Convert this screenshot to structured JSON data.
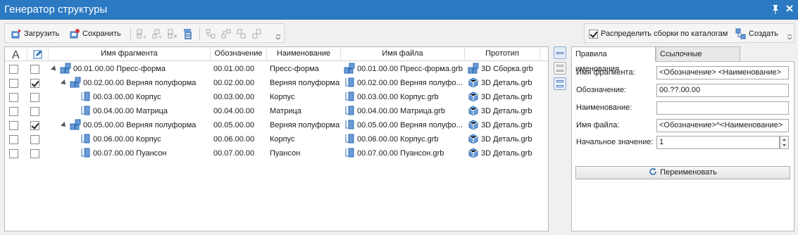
{
  "window": {
    "title": "Генератор структуры"
  },
  "toolbar": {
    "load_label": "Загрузить",
    "save_label": "Сохранить"
  },
  "toolbar_right": {
    "distribute_label": "Распределить сборки по каталогам",
    "distribute_checked": true,
    "create_label": "Создать"
  },
  "grid": {
    "columns": [
      "Имя фрагмента",
      "Обозначение",
      "Наименование",
      "Имя файла",
      "Прототип"
    ],
    "rows": [
      {
        "check1": false,
        "check2": false,
        "level": 0,
        "expand": true,
        "icon": "assembly",
        "fragment": "00.01.00.00 Пресс-форма",
        "designation": "00.01.00.00",
        "name": "Пресс-форма",
        "file": "00.01.00.00 Пресс-форма.grb",
        "file_icon": "assembly",
        "prototype": "3D Сборка.grb",
        "proto_icon": "assembly"
      },
      {
        "check1": false,
        "check2": true,
        "level": 1,
        "expand": true,
        "icon": "assembly",
        "fragment": "00.02.00.00 Верняя полуформа",
        "designation": "00.02.00.00",
        "name": "Верняя полуформа",
        "file": "00.02.00.00 Верняя полуфо...",
        "file_icon": "part",
        "prototype": "3D Деталь.grb",
        "proto_icon": "part"
      },
      {
        "check1": false,
        "check2": false,
        "level": 2,
        "expand": false,
        "icon": "part",
        "fragment": "00.03.00.00 Корпус",
        "designation": "00.03.00.00",
        "name": "Корпус",
        "file": "00.03.00.00 Корпус.grb",
        "file_icon": "part",
        "prototype": "3D Деталь.grb",
        "proto_icon": "part"
      },
      {
        "check1": false,
        "check2": false,
        "level": 2,
        "expand": false,
        "icon": "part",
        "fragment": "00.04.00.00 Матрица",
        "designation": "00.04.00.00",
        "name": "Матрица",
        "file": "00.04.00.00 Матрица.grb",
        "file_icon": "part",
        "prototype": "3D Деталь.grb",
        "proto_icon": "part"
      },
      {
        "check1": false,
        "check2": true,
        "level": 1,
        "expand": true,
        "icon": "assembly",
        "fragment": "00.05.00.00 Верняя полуформа",
        "designation": "00.05.00.00",
        "name": "Верняя полуформа",
        "file": "00.05.00.00 Верняя полуфо...",
        "file_icon": "part",
        "prototype": "3D Деталь.grb",
        "proto_icon": "part"
      },
      {
        "check1": false,
        "check2": false,
        "level": 2,
        "expand": false,
        "icon": "part",
        "fragment": "00.06.00.00 Корпус",
        "designation": "00.06.00.00",
        "name": "Корпус",
        "file": "00.06.00.00 Корпус.grb",
        "file_icon": "part",
        "prototype": "3D Деталь.grb",
        "proto_icon": "part"
      },
      {
        "check1": false,
        "check2": false,
        "level": 2,
        "expand": false,
        "icon": "part",
        "fragment": "00.07.00.00 Пуансон",
        "designation": "00.07.00.00",
        "name": "Пуансон",
        "file": "00.07.00.00 Пуансон.grb",
        "file_icon": "part",
        "prototype": "3D Деталь.grb",
        "proto_icon": "part"
      }
    ]
  },
  "panel": {
    "tabs": [
      "Правила именования",
      "Ссылочные элементы"
    ],
    "fields": [
      {
        "label": "Имя фрагмента:",
        "value": "<Обозначение> <Наименование>"
      },
      {
        "label": "Обозначение:",
        "value": "00.??.00.00"
      },
      {
        "label": "Наименование:",
        "value": ""
      },
      {
        "label": "Имя файла:",
        "value": "<Обозначение>^<Наименование>"
      }
    ],
    "start_label": "Начальное значение:",
    "start_value": "1",
    "rename_label": "Переименовать"
  },
  "colors": {
    "titlebar": "#2b79c2",
    "icon_blue": "#2e6db4",
    "accent": "#4a7ab8"
  }
}
